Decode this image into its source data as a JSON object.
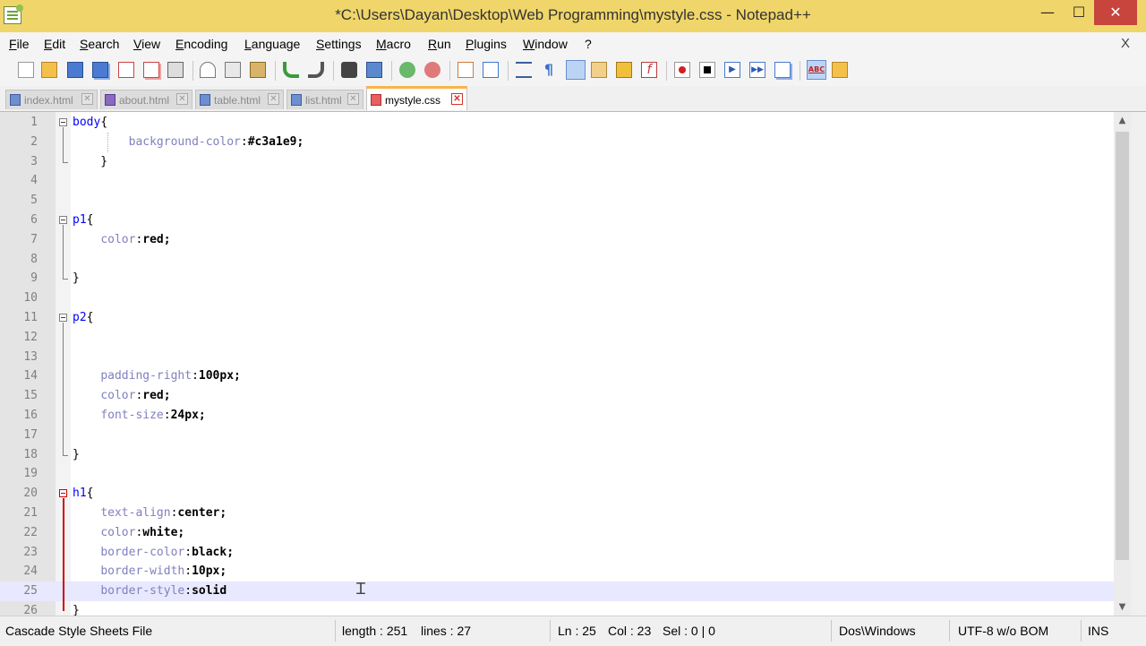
{
  "window": {
    "title": "*C:\\Users\\Dayan\\Desktop\\Web Programming\\mystyle.css - Notepad++",
    "minimize_glyph": "—",
    "maximize_glyph": "☐",
    "close_glyph": "✕"
  },
  "menu": {
    "items": [
      "File",
      "Edit",
      "Search",
      "View",
      "Encoding",
      "Language",
      "Settings",
      "Macro",
      "Run",
      "Plugins",
      "Window",
      "?"
    ],
    "close_doc_glyph": "X"
  },
  "toolbar": {
    "icons": [
      "new-file-icon",
      "open-file-icon",
      "save-icon",
      "save-all-icon",
      "close-icon",
      "close-all-icon",
      "print-icon",
      "cut-icon",
      "copy-icon",
      "paste-icon",
      "undo-icon",
      "redo-icon",
      "find-icon",
      "replace-icon",
      "zoom-in-icon",
      "zoom-out-icon",
      "sync-vertical-icon",
      "sync-horizontal-icon",
      "word-wrap-icon",
      "show-all-chars-icon",
      "indent-guide-icon",
      "user-language-icon",
      "document-map-icon",
      "function-list-icon",
      "record-macro-icon",
      "stop-record-icon",
      "play-macro-icon",
      "run-macro-multiple-icon",
      "save-macro-icon",
      "spell-check-icon",
      "folder-as-workspace-icon"
    ]
  },
  "tabs": [
    {
      "label": "index.html",
      "active": false
    },
    {
      "label": "about.html",
      "active": false
    },
    {
      "label": "table.html",
      "active": false
    },
    {
      "label": "list.html",
      "active": false
    },
    {
      "label": "mystyle.css",
      "active": true
    }
  ],
  "tab_close_glyph": "✕",
  "editor": {
    "current_line": 25,
    "lines": [
      {
        "n": "1",
        "sel": "body",
        "punc": "{",
        "prop": "",
        "val": ""
      },
      {
        "n": "2",
        "sel": "",
        "punc": "",
        "prop": "background-color",
        "val": "#c3a1e9;",
        "indent": "        "
      },
      {
        "n": "3",
        "sel": "",
        "punc": "    }",
        "prop": "",
        "val": ""
      },
      {
        "n": "4",
        "sel": "",
        "punc": "",
        "prop": "",
        "val": ""
      },
      {
        "n": "5",
        "sel": "",
        "punc": "",
        "prop": "",
        "val": ""
      },
      {
        "n": "6",
        "sel": "p1",
        "punc": "{",
        "prop": "",
        "val": ""
      },
      {
        "n": "7",
        "sel": "",
        "punc": "",
        "prop": "color",
        "val": "red;",
        "indent": "    "
      },
      {
        "n": "8",
        "sel": "",
        "punc": "",
        "prop": "",
        "val": ""
      },
      {
        "n": "9",
        "sel": "",
        "punc": "}",
        "prop": "",
        "val": ""
      },
      {
        "n": "10",
        "sel": "",
        "punc": "",
        "prop": "",
        "val": ""
      },
      {
        "n": "11",
        "sel": "p2",
        "punc": "{",
        "prop": "",
        "val": ""
      },
      {
        "n": "12",
        "sel": "",
        "punc": "",
        "prop": "",
        "val": ""
      },
      {
        "n": "13",
        "sel": "",
        "punc": "",
        "prop": "",
        "val": ""
      },
      {
        "n": "14",
        "sel": "",
        "punc": "",
        "prop": "padding-right",
        "val": "100px;",
        "indent": "    "
      },
      {
        "n": "15",
        "sel": "",
        "punc": "",
        "prop": "color",
        "val": "red;",
        "indent": "    "
      },
      {
        "n": "16",
        "sel": "",
        "punc": "",
        "prop": "font-size",
        "val": "24px;",
        "indent": "    "
      },
      {
        "n": "17",
        "sel": "",
        "punc": "",
        "prop": "",
        "val": ""
      },
      {
        "n": "18",
        "sel": "",
        "punc": "}",
        "prop": "",
        "val": ""
      },
      {
        "n": "19",
        "sel": "",
        "punc": "",
        "prop": "",
        "val": ""
      },
      {
        "n": "20",
        "sel": "h1",
        "punc": "{",
        "prop": "",
        "val": ""
      },
      {
        "n": "21",
        "sel": "",
        "punc": "",
        "prop": "text-align",
        "val": "center;",
        "indent": "    "
      },
      {
        "n": "22",
        "sel": "",
        "punc": "",
        "prop": "color",
        "val": "white;",
        "indent": "    "
      },
      {
        "n": "23",
        "sel": "",
        "punc": "",
        "prop": "border-color",
        "val": "black;",
        "indent": "    "
      },
      {
        "n": "24",
        "sel": "",
        "punc": "",
        "prop": "border-width",
        "val": "10px;",
        "indent": "    "
      },
      {
        "n": "25",
        "sel": "",
        "punc": "",
        "prop": "border-style",
        "val": "solid",
        "indent": "    "
      },
      {
        "n": "26",
        "sel": "",
        "punc": "}",
        "prop": "",
        "val": ""
      }
    ]
  },
  "scrollbar": {
    "up_glyph": "▲",
    "down_glyph": "▼"
  },
  "status": {
    "file_type": "Cascade Style Sheets File",
    "length": "length : 251",
    "lines": "lines : 27",
    "ln": "Ln : 25",
    "col": "Col : 23",
    "sel": "Sel : 0 | 0",
    "eol": "Dos\\Windows",
    "encoding": "UTF-8 w/o BOM",
    "mode": "INS"
  },
  "colors": {
    "titlebar": "#f0d66a",
    "close_button": "#c7453c",
    "active_tab_accent": "#fab34a",
    "selector": "#0000ff",
    "property": "#8080c0",
    "current_line": "#e8e8ff"
  }
}
